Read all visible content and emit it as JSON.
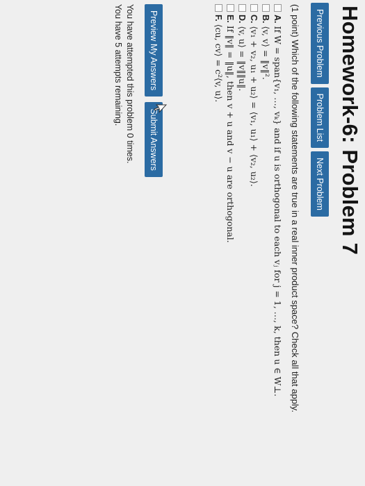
{
  "page": {
    "title": "Homework-6: Problem 7"
  },
  "nav": {
    "previous": "Previous Problem",
    "list": "Problem List",
    "next": "Next Problem"
  },
  "question": "(1 point) Which of the following statements are true in a real inner product space? Check all that apply.",
  "options": [
    {
      "letter": "A.",
      "text": "If W = span{v₁, …, vₖ} and if u is orthogonal to each vⱼ for j = 1, …, k, then u ∈ W⊥."
    },
    {
      "letter": "B.",
      "text": "⟨v, v⟩ = ‖v‖²."
    },
    {
      "letter": "C.",
      "text": "⟨v₁ + v₂, u₁ + u₂⟩ = ⟨v₁, u₁⟩ + ⟨v₂, u₂⟩."
    },
    {
      "letter": "D.",
      "text": "⟨v, u⟩ = ‖v‖‖u‖."
    },
    {
      "letter": "E.",
      "text": "If ‖v‖ = ‖u‖, then v + u and v − u are orthogonal."
    },
    {
      "letter": "F.",
      "text": "⟨cu, cv⟩ = c²⟨v, u⟩."
    }
  ],
  "actions": {
    "preview": "Preview My Answers",
    "submit": "Submit Answers"
  },
  "status": {
    "attempted": "You have attempted this problem 0 times.",
    "remaining": "You have 5 attempts remaining."
  }
}
